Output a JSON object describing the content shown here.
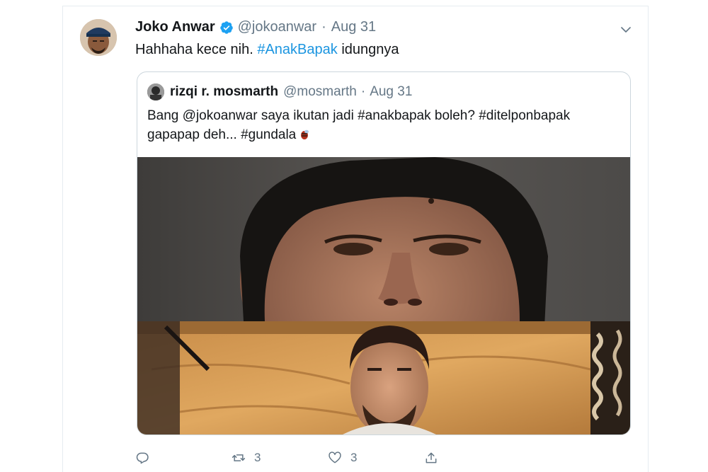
{
  "tweet": {
    "author_name": "Joko Anwar",
    "handle": "@jokoanwar",
    "separator": "·",
    "date": "Aug 31",
    "text_before": "Hahhaha kece nih. ",
    "hashtag": "#AnakBapak",
    "text_after": " idungnya"
  },
  "quoted_tweet": {
    "author_name": "rizqi r. mosmarth",
    "handle": "@mosmarth",
    "separator": "·",
    "date": "Aug 31",
    "line1": "Bang @jokoanwar saya ikutan jadi #anakbapak boleh? #ditelponbapak",
    "line2": "gapapap deh... #gundala"
  },
  "actions": {
    "reply_count": "",
    "retweet_count": "3",
    "like_count": "3"
  },
  "colors": {
    "link": "#1b95e0",
    "muted": "#657786",
    "text": "#14171a",
    "verified": "#1da1f2"
  },
  "icons": [
    "verified-badge-icon",
    "chevron-down-icon",
    "reply-icon",
    "retweet-icon",
    "like-icon",
    "share-icon",
    "bee-emoji-icon"
  ]
}
